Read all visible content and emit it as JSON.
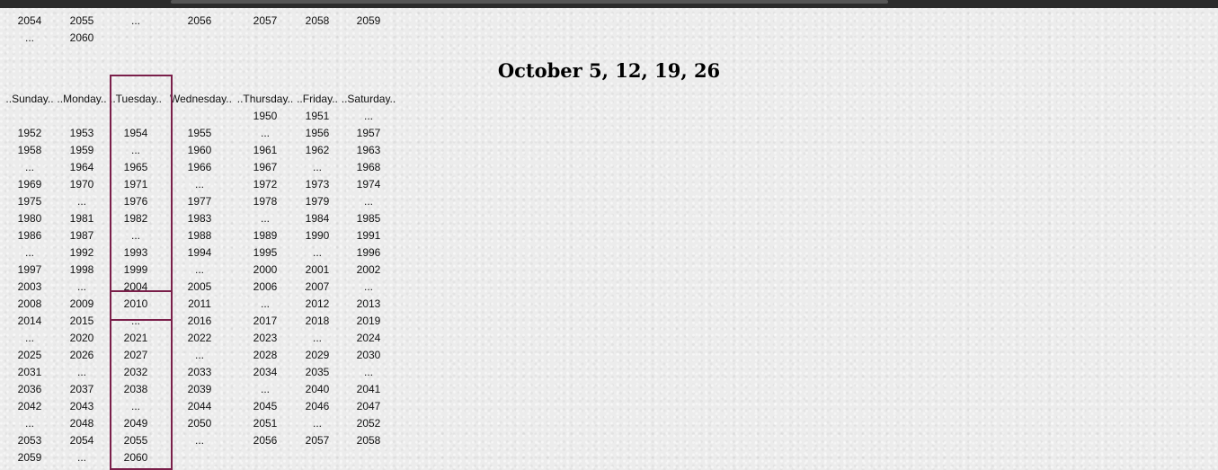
{
  "top_rows": [
    [
      "2054",
      "2055",
      "...",
      "2056",
      "2057",
      "2058",
      "2059"
    ],
    [
      "...",
      "2060"
    ]
  ],
  "title": "October 5, 12, 19, 26",
  "headers": [
    "..Sunday..",
    "..Monday..",
    "..Tuesday..",
    "Wednesday..",
    "..Thursday..",
    "..Friday..",
    "..Saturday.."
  ],
  "rows": [
    [
      "",
      "",
      "",
      "",
      "1950",
      "1951",
      "..."
    ],
    [
      "1952",
      "1953",
      "1954",
      "1955",
      "...",
      "1956",
      "1957"
    ],
    [
      "1958",
      "1959",
      "...",
      "1960",
      "1961",
      "1962",
      "1963"
    ],
    [
      "...",
      "1964",
      "1965",
      "1966",
      "1967",
      "...",
      "1968"
    ],
    [
      "1969",
      "1970",
      "1971",
      "...",
      "1972",
      "1973",
      "1974"
    ],
    [
      "1975",
      "...",
      "1976",
      "1977",
      "1978",
      "1979",
      "..."
    ],
    [
      "1980",
      "1981",
      "1982",
      "1983",
      "...",
      "1984",
      "1985"
    ],
    [
      "1986",
      "1987",
      "...",
      "1988",
      "1989",
      "1990",
      "1991"
    ],
    [
      "...",
      "1992",
      "1993",
      "1994",
      "1995",
      "...",
      "1996"
    ],
    [
      "1997",
      "1998",
      "1999",
      "...",
      "2000",
      "2001",
      "2002"
    ],
    [
      "2003",
      "...",
      "2004",
      "2005",
      "2006",
      "2007",
      "..."
    ],
    [
      "2008",
      "2009",
      "2010",
      "2011",
      "...",
      "2012",
      "2013"
    ],
    [
      "2014",
      "2015",
      "...",
      "2016",
      "2017",
      "2018",
      "2019"
    ],
    [
      "...",
      "2020",
      "2021",
      "2022",
      "2023",
      "...",
      "2024"
    ],
    [
      "2025",
      "2026",
      "2027",
      "...",
      "2028",
      "2029",
      "2030"
    ],
    [
      "2031",
      "...",
      "2032",
      "2033",
      "2034",
      "2035",
      "..."
    ],
    [
      "2036",
      "2037",
      "2038",
      "2039",
      "...",
      "2040",
      "2041"
    ],
    [
      "2042",
      "2043",
      "...",
      "2044",
      "2045",
      "2046",
      "2047"
    ],
    [
      "...",
      "2048",
      "2049",
      "2050",
      "2051",
      "...",
      "2052"
    ],
    [
      "2053",
      "2054",
      "2055",
      "...",
      "2056",
      "2057",
      "2058"
    ],
    [
      "2059",
      "...",
      "2060"
    ]
  ],
  "highlight": {
    "column": 2,
    "cell_row": 11,
    "color": "#7a1f4a"
  }
}
